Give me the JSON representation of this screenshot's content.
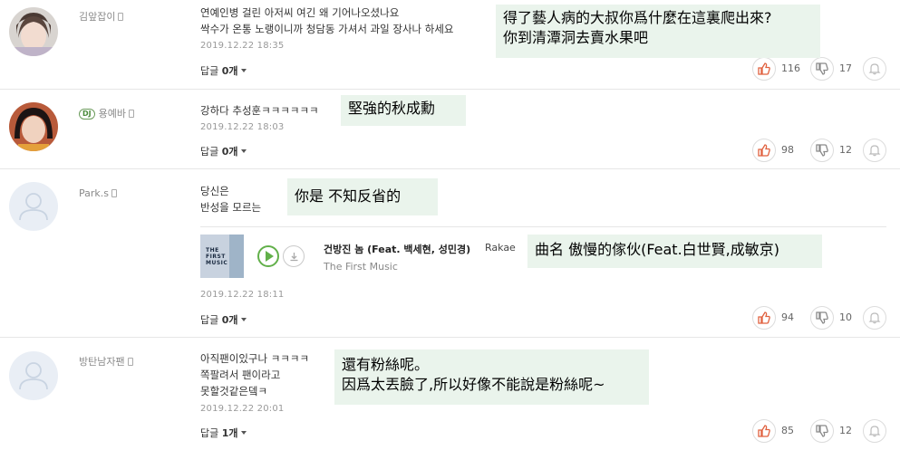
{
  "comments": [
    {
      "nickname": "김앞잡이",
      "lines": [
        "연예인병 걸린 아저씨 여긴 왜 기어나오셨나요",
        "싹수가 온통 노랭이니까 청담동 가셔서 과일 장사나 하세요"
      ],
      "date": "2019.12.22  18:35",
      "reply_label": "답글 ",
      "reply_count": "0개",
      "likes": "116",
      "dislikes": "17",
      "overlay": [
        "得了藝人病的大叔你爲什麼在這裏爬出來?",
        "你到清潭洞去賣水果吧"
      ]
    },
    {
      "badge": "DJ",
      "nickname": "용예바",
      "lines": [
        "강하다 추성훈ㅋㅋㅋㅋㅋㅋ"
      ],
      "date": "2019.12.22  18:03",
      "reply_label": "답글 ",
      "reply_count": "0개",
      "likes": "98",
      "dislikes": "12",
      "overlay": [
        "堅強的秋成勳"
      ]
    },
    {
      "nickname": "Park.s",
      "lines": [
        "당신은",
        "반성을 모르는"
      ],
      "date": "2019.12.22  18:11",
      "reply_label": "답글 ",
      "reply_count": "0개",
      "likes": "94",
      "dislikes": "10",
      "overlay": [
        "你是 不知反省的"
      ],
      "music": {
        "album_art_text": [
          "THE",
          "FIRST",
          "MUSIC"
        ],
        "title": "건방진 놈 (Feat. 백세현, 성민경)",
        "artist": "Rakae",
        "album": "The First Music",
        "overlay": "曲名  傲慢的傢伙(Feat.白世賢,成敏京)"
      }
    },
    {
      "nickname": "방탄남자팬",
      "lines": [
        "아직팬이있구나 ㅋㅋㅋㅋ",
        "쪽팔려서 팬이라고",
        "못할것같은뎈ㅋ"
      ],
      "date": "2019.12.22  20:01",
      "reply_label": "답글 ",
      "reply_count": "1개",
      "likes": "85",
      "dislikes": "12",
      "overlay": [
        "還有粉絲呢。",
        "因爲太丟臉了,所以好像不能說是粉絲呢~"
      ]
    }
  ],
  "icons": {
    "like": "thumbs-up-icon",
    "dislike": "thumbs-down-icon",
    "report": "bell-icon",
    "device": "mobile-device-icon",
    "play": "play-icon",
    "download": "download-icon"
  },
  "colors": {
    "overlay_bg": "#eaf4ec",
    "like_accent": "#e0613f",
    "play_green": "#62b04a",
    "meta_gray": "#999999"
  }
}
